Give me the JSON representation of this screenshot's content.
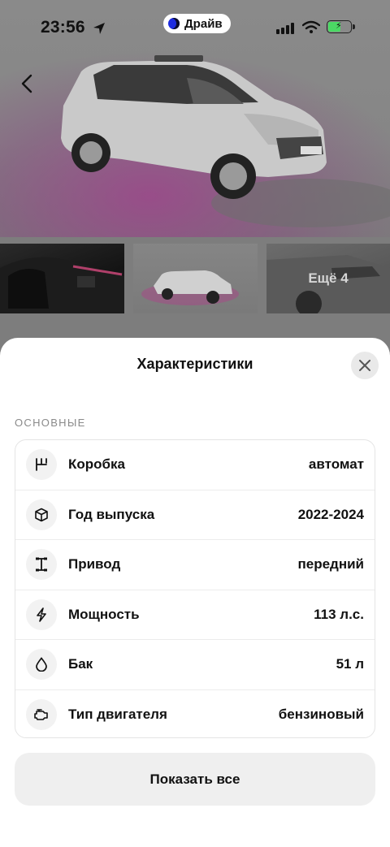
{
  "status_bar": {
    "time": "23:56",
    "drive_label": "Драйв"
  },
  "thumbnails": {
    "more_label": "Ещё 4"
  },
  "sheet": {
    "title": "Характеристики",
    "section_label": "ОСНОВНЫЕ",
    "specs": [
      {
        "icon": "gearbox-icon",
        "name": "Коробка",
        "value": "автомат"
      },
      {
        "icon": "cube-icon",
        "name": "Год выпуска",
        "value": "2022-2024"
      },
      {
        "icon": "drive-axle-icon",
        "name": "Привод",
        "value": "передний"
      },
      {
        "icon": "lightning-icon",
        "name": "Мощность",
        "value": "113 л.с."
      },
      {
        "icon": "drop-icon",
        "name": "Бак",
        "value": "51 л"
      },
      {
        "icon": "engine-icon",
        "name": "Тип двигателя",
        "value": "бензиновый"
      }
    ],
    "show_all_label": "Показать все"
  },
  "colors": {
    "overlay": "#7d7d7d",
    "sheet_bg": "#ffffff",
    "button_bg": "#efefef",
    "drive_accent": "#1d2be0",
    "battery_green": "#4bd964"
  }
}
